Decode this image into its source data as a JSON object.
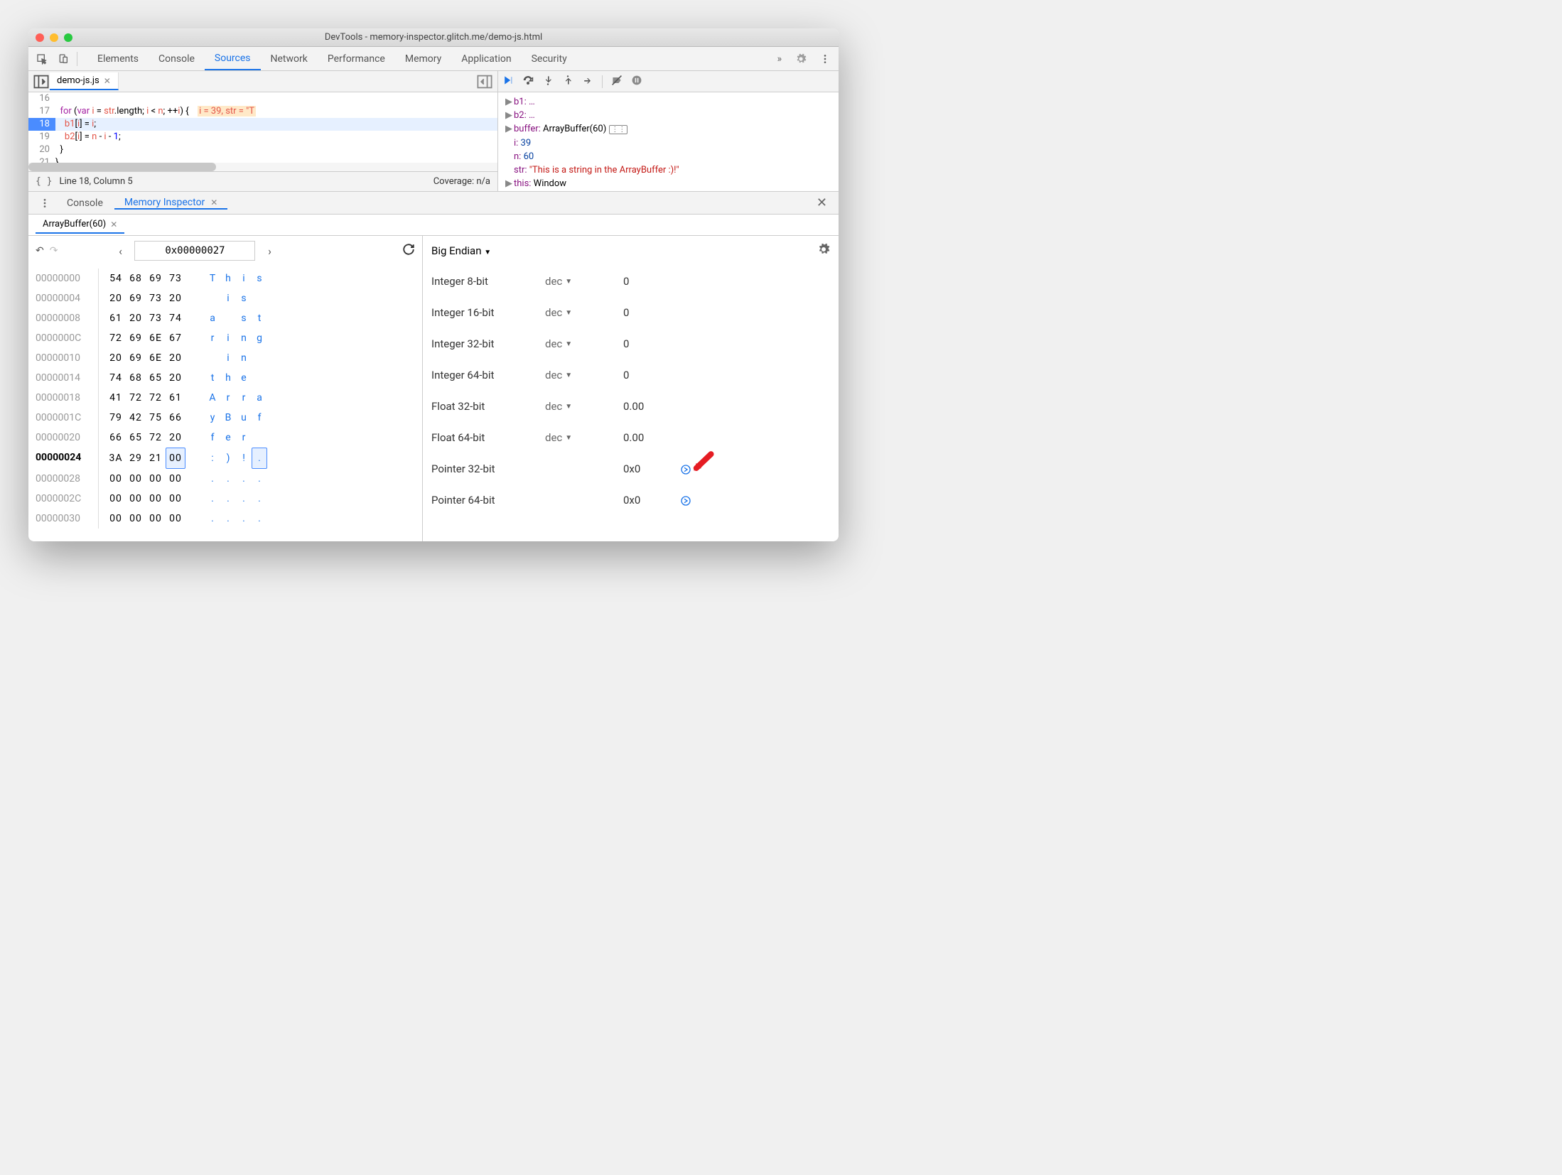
{
  "window": {
    "title": "DevTools - memory-inspector.glitch.me/demo-js.html"
  },
  "mainTabs": [
    "Elements",
    "Console",
    "Sources",
    "Network",
    "Performance",
    "Memory",
    "Application",
    "Security"
  ],
  "activeMainTab": "Sources",
  "moreTabs": "»",
  "file": {
    "name": "demo-js.js"
  },
  "code": {
    "startLine": 16,
    "currentLine": 18,
    "lines": {
      "l16": "",
      "l17_pre": "  for (var i = str.length; i < n; ++i) {",
      "l17_inline": "i = 39, str = \"T",
      "l18": "    b1[i] = i;",
      "l19": "    b2[i] = n - i - 1;",
      "l20": "  }",
      "l21": "}",
      "l22": ""
    }
  },
  "status": {
    "pos": "Line 18, Column 5",
    "coverage": "Coverage: n/a"
  },
  "scope": {
    "b1": "b1: …",
    "b2": "b2: …",
    "buffer_label": "buffer:",
    "buffer_val": "ArrayBuffer(60)",
    "i_label": "i:",
    "i_val": "39",
    "n_label": "n:",
    "n_val": "60",
    "str_label": "str:",
    "str_val": "\"This is a string in the ArrayBuffer :)!\"",
    "this_label": "this:",
    "this_val": "Window"
  },
  "drawer": {
    "tabs": {
      "console": "Console",
      "memory": "Memory Inspector"
    },
    "activeTab": "Memory Inspector",
    "bufferTab": "ArrayBuffer(60)"
  },
  "hex": {
    "address": "0x00000027",
    "rows": [
      {
        "addr": "00000000",
        "b": [
          "54",
          "68",
          "69",
          "73"
        ],
        "a": [
          "T",
          "h",
          "i",
          "s"
        ],
        "bold": false
      },
      {
        "addr": "00000004",
        "b": [
          "20",
          "69",
          "73",
          "20"
        ],
        "a": [
          " ",
          "i",
          "s",
          " "
        ],
        "bold": false
      },
      {
        "addr": "00000008",
        "b": [
          "61",
          "20",
          "73",
          "74"
        ],
        "a": [
          "a",
          " ",
          "s",
          "t"
        ],
        "bold": false
      },
      {
        "addr": "0000000C",
        "b": [
          "72",
          "69",
          "6E",
          "67"
        ],
        "a": [
          "r",
          "i",
          "n",
          "g"
        ],
        "bold": false
      },
      {
        "addr": "00000010",
        "b": [
          "20",
          "69",
          "6E",
          "20"
        ],
        "a": [
          " ",
          "i",
          "n",
          " "
        ],
        "bold": false
      },
      {
        "addr": "00000014",
        "b": [
          "74",
          "68",
          "65",
          "20"
        ],
        "a": [
          "t",
          "h",
          "e",
          " "
        ],
        "bold": false
      },
      {
        "addr": "00000018",
        "b": [
          "41",
          "72",
          "72",
          "61"
        ],
        "a": [
          "A",
          "r",
          "r",
          "a"
        ],
        "bold": false
      },
      {
        "addr": "0000001C",
        "b": [
          "79",
          "42",
          "75",
          "66"
        ],
        "a": [
          "y",
          "B",
          "u",
          "f"
        ],
        "bold": false
      },
      {
        "addr": "00000020",
        "b": [
          "66",
          "65",
          "72",
          "20"
        ],
        "a": [
          "f",
          "e",
          "r",
          " "
        ],
        "bold": false
      },
      {
        "addr": "00000024",
        "b": [
          "3A",
          "29",
          "21",
          "00"
        ],
        "a": [
          ":",
          ")",
          "!",
          "."
        ],
        "bold": true,
        "cursor": 3
      },
      {
        "addr": "00000028",
        "b": [
          "00",
          "00",
          "00",
          "00"
        ],
        "a": [
          ".",
          ".",
          ".",
          "."
        ],
        "bold": false
      },
      {
        "addr": "0000002C",
        "b": [
          "00",
          "00",
          "00",
          "00"
        ],
        "a": [
          ".",
          ".",
          ".",
          "."
        ],
        "bold": false
      },
      {
        "addr": "00000030",
        "b": [
          "00",
          "00",
          "00",
          "00"
        ],
        "a": [
          ".",
          ".",
          ".",
          "."
        ],
        "bold": false
      }
    ]
  },
  "valuePanel": {
    "endian": "Big Endian",
    "rows": [
      {
        "type": "Integer 8-bit",
        "fmt": "dec",
        "val": "0"
      },
      {
        "type": "Integer 16-bit",
        "fmt": "dec",
        "val": "0"
      },
      {
        "type": "Integer 32-bit",
        "fmt": "dec",
        "val": "0"
      },
      {
        "type": "Integer 64-bit",
        "fmt": "dec",
        "val": "0"
      },
      {
        "type": "Float 32-bit",
        "fmt": "dec",
        "val": "0.00"
      },
      {
        "type": "Float 64-bit",
        "fmt": "dec",
        "val": "0.00"
      },
      {
        "type": "Pointer 32-bit",
        "fmt": "",
        "val": "0x0",
        "jump": true,
        "arrow": true
      },
      {
        "type": "Pointer 64-bit",
        "fmt": "",
        "val": "0x0",
        "jump": true
      }
    ]
  }
}
